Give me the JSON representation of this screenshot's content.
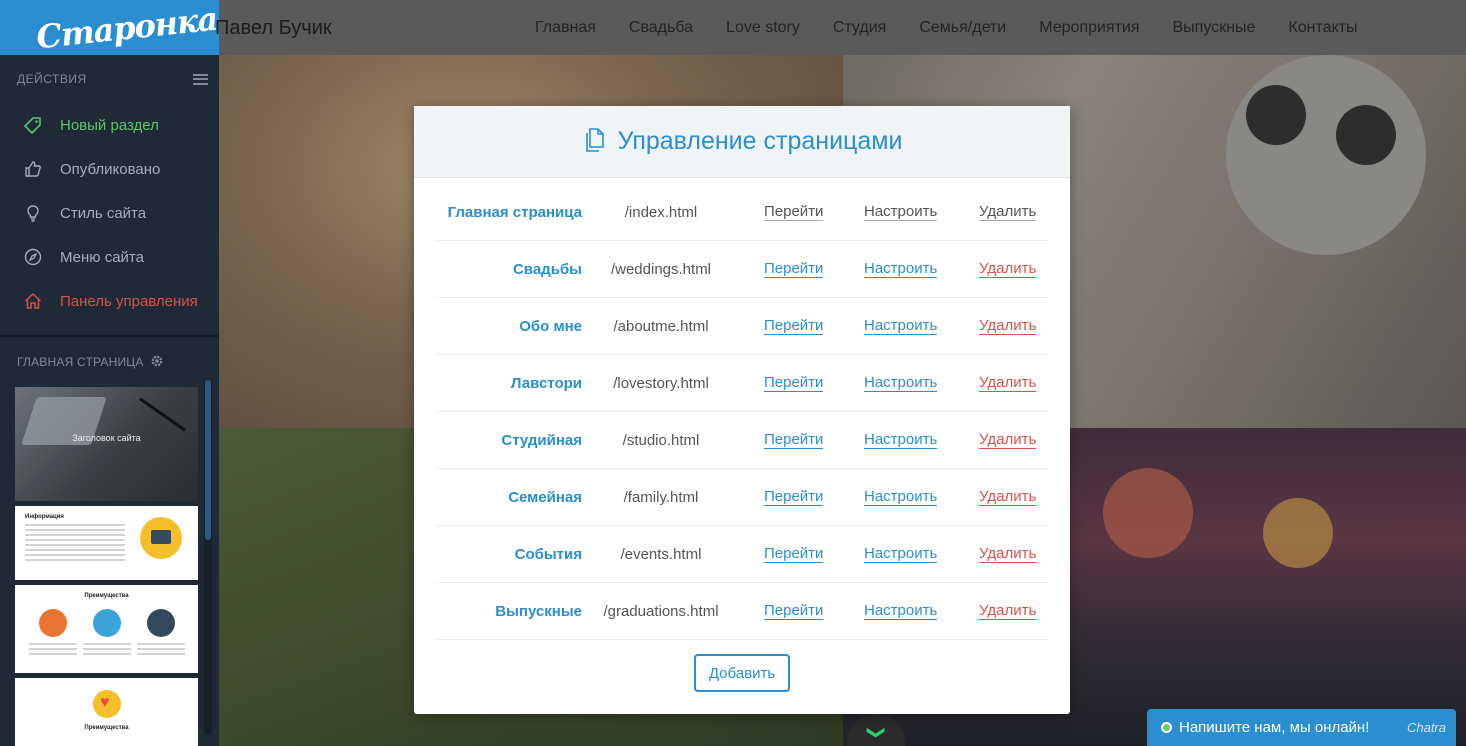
{
  "sidebar": {
    "logo": "Старонка",
    "actions_heading": "ДЕЙСТВИЯ",
    "items": [
      {
        "label": "Новый раздел",
        "icon": "tag-plus-icon",
        "color": "#5ec46f"
      },
      {
        "label": "Опубликовано",
        "icon": "thumbs-up-icon"
      },
      {
        "label": "Стиль сайта",
        "icon": "lightbulb-icon"
      },
      {
        "label": "Меню сайта",
        "icon": "compass-icon"
      },
      {
        "label": "Панель управления",
        "icon": "home-icon",
        "color": "#d8524c"
      }
    ],
    "page_heading": "ГЛАВНАЯ СТРАНИЦА",
    "thumbnails": [
      {
        "title": "Заголовок сайта"
      },
      {
        "title": "Информация"
      },
      {
        "title": "Преимущества"
      },
      {
        "title": "Преимущества"
      }
    ]
  },
  "topbar": {
    "site_title": "Павел Бучик",
    "nav": [
      "Главная",
      "Свадьба",
      "Love story",
      "Студия",
      "Семья/дети",
      "Мероприятия",
      "Выпускные",
      "Контакты"
    ]
  },
  "modal": {
    "title": "Управление страницами",
    "title_icon": "pages-icon",
    "pages": [
      {
        "name": "Главная страница",
        "path": "/index.html",
        "go": "Перейти",
        "configure": "Настроить",
        "delete": "Удалить"
      },
      {
        "name": "Свадьбы",
        "path": "/weddings.html",
        "go": "Перейти",
        "configure": "Настроить",
        "delete": "Удалить"
      },
      {
        "name": "Обо мне",
        "path": "/aboutme.html",
        "go": "Перейти",
        "configure": "Настроить",
        "delete": "Удалить"
      },
      {
        "name": "Лавстори",
        "path": "/lovestory.html",
        "go": "Перейти",
        "configure": "Настроить",
        "delete": "Удалить"
      },
      {
        "name": "Студийная",
        "path": "/studio.html",
        "go": "Перейти",
        "configure": "Настроить",
        "delete": "Удалить"
      },
      {
        "name": "Семейная",
        "path": "/family.html",
        "go": "Перейти",
        "configure": "Настроить",
        "delete": "Удалить"
      },
      {
        "name": "События",
        "path": "/events.html",
        "go": "Перейти",
        "configure": "Настроить",
        "delete": "Удалить"
      },
      {
        "name": "Выпускные",
        "path": "/graduations.html",
        "go": "Перейти",
        "configure": "Настроить",
        "delete": "Удалить"
      }
    ],
    "add_label": "Добавить"
  },
  "chat": {
    "label": "Напишите нам, мы онлайн!",
    "brand": "Chatra"
  },
  "colors": {
    "accent": "#2a8ed0",
    "success": "#5ec46f",
    "danger": "#d8524c",
    "sidebar_bg": "#1f2a36"
  }
}
